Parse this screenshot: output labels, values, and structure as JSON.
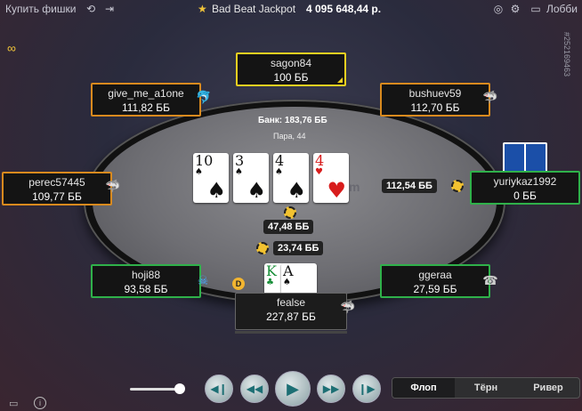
{
  "topbar": {
    "buy_chips": "Купить фишки",
    "jackpot_label": "Bad Beat Jackpot",
    "jackpot_amount": "4 095 648,44 р.",
    "lobby": "Лобби",
    "table_id": "#252169463"
  },
  "pot": {
    "bank": "Банк: 183,76 ББ",
    "hand_name": "Пара, 44"
  },
  "board": [
    {
      "rank": "10",
      "suit": "♠",
      "color": "#111111"
    },
    {
      "rank": "3",
      "suit": "♠",
      "color": "#111111"
    },
    {
      "rank": "4",
      "suit": "♠",
      "color": "#111111"
    },
    {
      "rank": "4",
      "suit": "♥",
      "color": "#d81c1c"
    }
  ],
  "hero_cards": [
    {
      "rank": "K",
      "suit": "♣",
      "color": "#1a8f3a"
    },
    {
      "rank": "A",
      "suit": "♠",
      "color": "#111111"
    }
  ],
  "players": {
    "sagon84": {
      "name": "sagon84",
      "stack": "100 ББ"
    },
    "give_me_a1one": {
      "name": "give_me_a1one",
      "stack": "111,82 ББ"
    },
    "bushuev59": {
      "name": "bushuev59",
      "stack": "112,70 ББ"
    },
    "perec57445": {
      "name": "perec57445",
      "stack": "109,77 ББ"
    },
    "yuriykaz1992": {
      "name": "yuriykaz1992",
      "stack": "0 ББ"
    },
    "hoji88": {
      "name": "hoji88",
      "stack": "93,58 ББ"
    },
    "ggeraa": {
      "name": "ggeraa",
      "stack": "27,59 ББ"
    },
    "fealse": {
      "name": "fealse",
      "stack": "227,87 ББ"
    }
  },
  "bets": {
    "yuriykaz1992": "112,54 ББ",
    "center": "47,48 ББ",
    "hoji88": "23,74 ББ"
  },
  "dealer_button": "D",
  "streets": [
    {
      "label": "Флоп",
      "active": true
    },
    {
      "label": "Тёрн",
      "active": false
    },
    {
      "label": "Ривер",
      "active": false
    }
  ],
  "colors": {
    "accent_orange": "#d98a1e",
    "accent_green": "#2fb14a",
    "accent_yellow": "#f0d020"
  },
  "replay_slider_fraction": 1.0
}
